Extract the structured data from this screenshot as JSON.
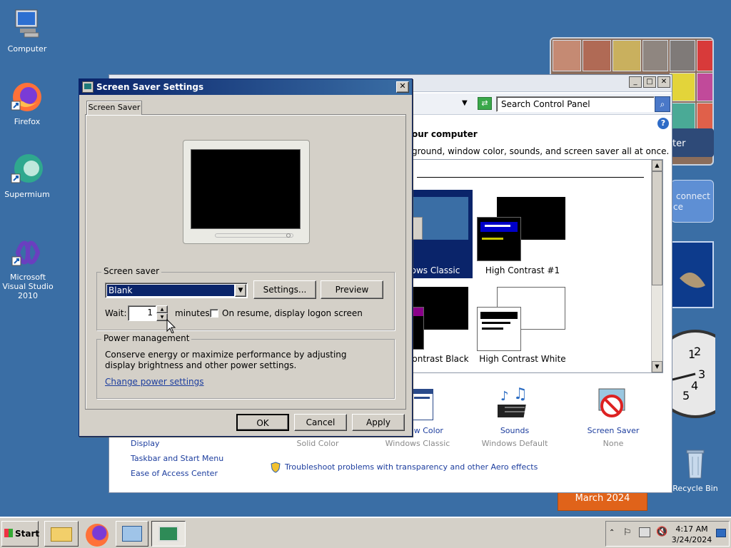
{
  "desktop": {
    "icons": [
      {
        "label": "Computer"
      },
      {
        "label": "Firefox"
      },
      {
        "label": "Supermium"
      },
      {
        "label": "Microsoft Visual Studio 2010"
      },
      {
        "label": "Recycle Bin"
      }
    ],
    "calendar_gadget": "March 2024",
    "gadget_text": {
      "connect1": "connect",
      "connect2": "ce",
      "ster": "ter"
    }
  },
  "control_panel": {
    "search_placeholder": "Search Control Panel",
    "heading": "our computer",
    "subheading": "ground, window color, sounds, and screen saver all at once.",
    "themes": [
      {
        "label": "ows Classic"
      },
      {
        "label": "High Contrast #1"
      },
      {
        "label": "ontrast Black"
      },
      {
        "label": "High Contrast White"
      }
    ],
    "settings_items": [
      {
        "label": "ow Color",
        "sub": "Windows Classic"
      },
      {
        "label": "Sounds",
        "sub": "Windows Default"
      },
      {
        "label": "Screen Saver",
        "sub": "None"
      }
    ],
    "solid_color": "Solid Color",
    "left_links": [
      "Display",
      "Taskbar and Start Menu",
      "Ease of Access Center"
    ],
    "troubleshoot_link": "Troubleshoot problems with transparency and other Aero effects"
  },
  "dialog": {
    "title": "Screen Saver Settings",
    "tab": "Screen Saver",
    "screensaver_group": "Screen saver",
    "screensaver_selected": "Blank",
    "settings_button": "Settings...",
    "preview_button": "Preview",
    "wait_label": "Wait:",
    "wait_value": "1",
    "minutes_label": "minutes",
    "resume_label": "On resume, display logon screen",
    "power_group": "Power management",
    "power_text": "Conserve energy or maximize performance by adjusting display brightness and other power settings.",
    "power_link": "Change power settings",
    "ok_button": "OK",
    "cancel_button": "Cancel",
    "apply_button": "Apply"
  },
  "taskbar": {
    "start_label": "Start",
    "time": "4:17 AM",
    "date": "3/24/2024"
  }
}
